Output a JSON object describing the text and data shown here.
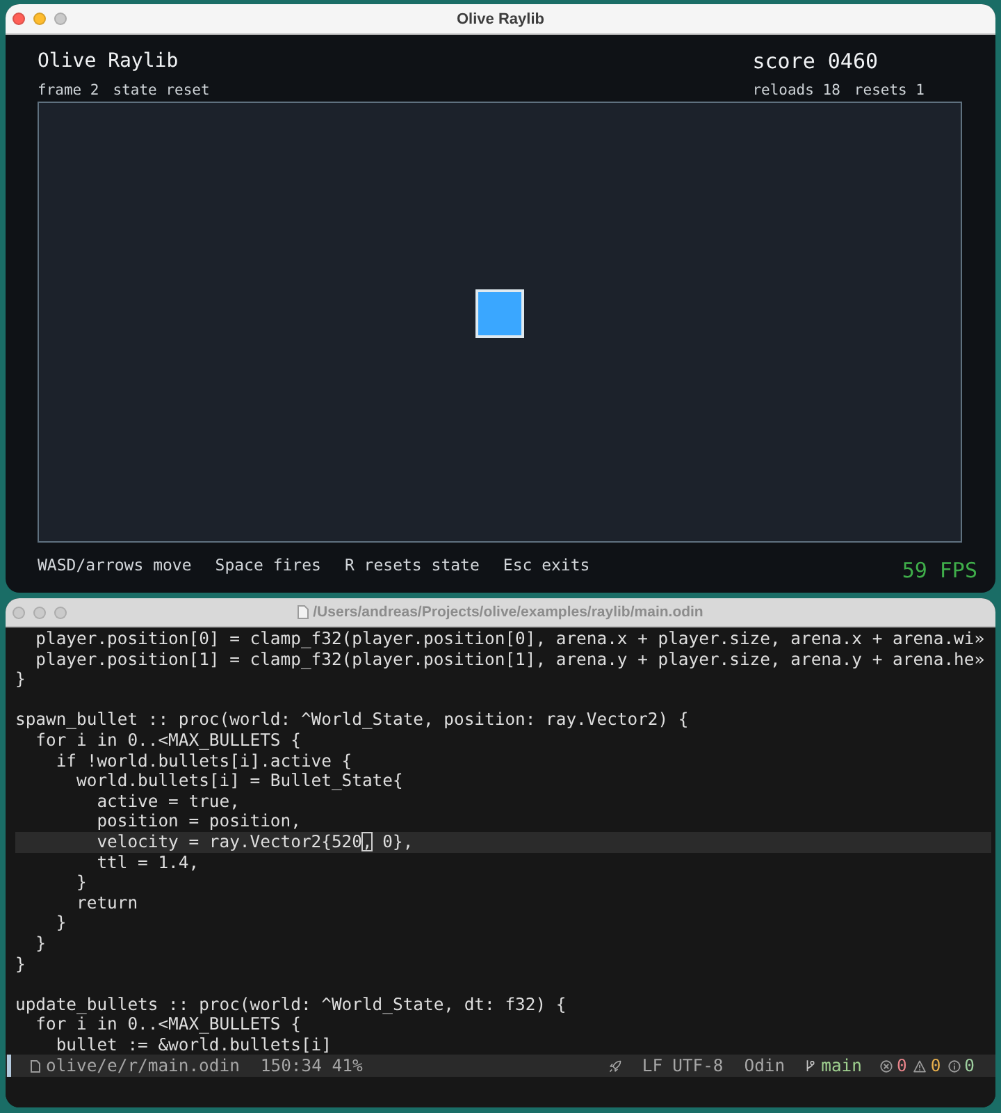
{
  "game_window": {
    "title": "Olive Raylib",
    "active": true,
    "controls": [
      {
        "kind": "close",
        "disabled": false
      },
      {
        "kind": "minimize",
        "disabled": false
      },
      {
        "kind": "zoom",
        "disabled": true
      }
    ]
  },
  "game": {
    "heading": "Olive Raylib",
    "stats": [
      "frame 2",
      "state reset"
    ],
    "score": "score 0460",
    "counters": [
      "reloads 18",
      "resets 1"
    ],
    "hints": [
      "WASD/arrows move",
      "Space fires",
      "R resets state",
      "Esc exits"
    ],
    "fps": "59 FPS"
  },
  "editor_window": {
    "title": "/Users/andreas/Projects/olive/examples/raylib/main.odin",
    "active": false
  },
  "code_lines": [
    {
      "kind": "code",
      "text": "  player.position[0] = clamp_f32(player.position[0], arena.x + player.size, arena.x + arena.wi»",
      "current": false
    },
    {
      "kind": "code",
      "text": "  player.position[1] = clamp_f32(player.position[1], arena.y + player.size, arena.y + arena.he»",
      "current": false
    },
    {
      "kind": "code",
      "text": "}",
      "current": false
    },
    {
      "kind": "blank",
      "current": false
    },
    {
      "kind": "code",
      "text": "spawn_bullet :: proc(world: ^World_State, position: ray.Vector2) {",
      "current": false
    },
    {
      "kind": "code",
      "text": "  for i in 0..<MAX_BULLETS {",
      "current": false
    },
    {
      "kind": "code",
      "text": "    if !world.bullets[i].active {",
      "current": false
    },
    {
      "kind": "code",
      "text": "      world.bullets[i] = Bullet_State{",
      "current": false
    },
    {
      "kind": "code",
      "text": "        active = true,",
      "current": false
    },
    {
      "kind": "code",
      "text": "        position = position,",
      "current": false
    },
    {
      "kind": "code",
      "text": "        velocity = ray.Vector2{520",
      "cursor": ",",
      "after": " 0},",
      "current": true
    },
    {
      "kind": "code",
      "text": "        ttl = 1.4,",
      "current": false
    },
    {
      "kind": "code",
      "text": "      }",
      "current": false
    },
    {
      "kind": "code",
      "text": "      return",
      "current": false
    },
    {
      "kind": "code",
      "text": "    }",
      "current": false
    },
    {
      "kind": "code",
      "text": "  }",
      "current": false
    },
    {
      "kind": "code",
      "text": "}",
      "current": false
    },
    {
      "kind": "blank",
      "current": false
    },
    {
      "kind": "code",
      "text": "update_bullets :: proc(world: ^World_State, dt: f32) {",
      "current": false
    },
    {
      "kind": "code",
      "text": "  for i in 0..<MAX_BULLETS {",
      "current": false
    },
    {
      "kind": "code",
      "text": "    bullet := &world.bullets[i]",
      "current": false
    }
  ],
  "status_bar": {
    "file": "olive/e/r/main.odin",
    "position": "150:34 41%",
    "line_ending": "LF",
    "encoding": "UTF-8",
    "language": "Odin",
    "branch": "main",
    "diagnostics": [
      {
        "kind": "error",
        "count": "0",
        "color": "#e8848a"
      },
      {
        "kind": "warning",
        "count": "0",
        "color": "#e8b04c"
      },
      {
        "kind": "info",
        "count": "0",
        "color": "#9fd0a0"
      }
    ]
  }
}
